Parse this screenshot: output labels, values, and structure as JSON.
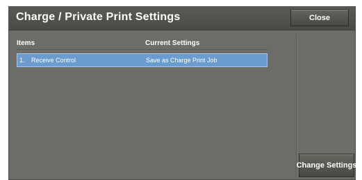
{
  "window": {
    "title": "Charge / Private Print Settings",
    "close_label": "Close"
  },
  "table": {
    "columns": [
      "Items",
      "Current Settings"
    ],
    "rows": [
      {
        "number": "1.",
        "item": "Receive Control",
        "value": "Save as Charge Print Job",
        "selected": true
      }
    ]
  },
  "actions": {
    "change_label": "Change Settings"
  },
  "colors": {
    "panel": "#6c6c68",
    "title_bar": "#4a4a47",
    "selection": "#6a9ccf"
  }
}
